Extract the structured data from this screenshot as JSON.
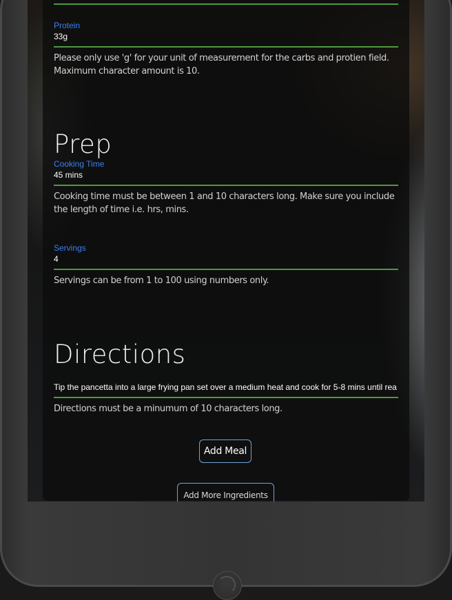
{
  "form": {
    "protein": {
      "label": "Protein",
      "value": "33g",
      "hint": "Please only use 'g' for your unit of measurement for the carbs and protien field. Maximum character amount is 10."
    },
    "prep_heading": "Prep",
    "cooking_time": {
      "label": "Cooking Time",
      "value": "45 mins",
      "hint": "Cooking time must be between 1 and 10 characters long. Make sure you include the length of time i.e. hrs, mins."
    },
    "servings": {
      "label": "Servings",
      "value": "4",
      "hint": "Servings can be from 1 to 100 using numbers only."
    },
    "directions_heading": "Directions",
    "directions": {
      "value": "Tip the pancetta into a large frying pan set over a medium heat and cook for 5-8 mins until rea",
      "hint": "Directions must be a minumum of 10 characters long."
    },
    "add_meal_label": "Add Meal",
    "add_ingredients_label": "Add More Ingredients"
  },
  "colors": {
    "label_blue": "#3d7ff0",
    "underline_green": "#4e9a3f",
    "button_border": "#6fa6d8"
  }
}
